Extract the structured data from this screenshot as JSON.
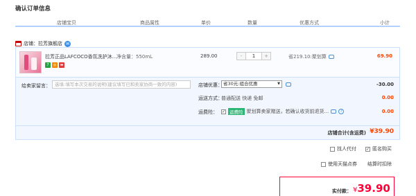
{
  "page_title": "确认订单信息",
  "columns": [
    "店铺宝贝",
    "商品属性",
    "单价",
    "数量",
    "优惠方式",
    "小计"
  ],
  "shop": {
    "label": "店铺：拉芳旗舰店"
  },
  "item": {
    "name": "拉芳正品LAFCOCO香氛洗护沐...",
    "spec": "净含量：550mL",
    "price": "289.00",
    "quantity": "1",
    "minus": "-",
    "plus": "+",
    "promo": "省219.10:聚划算",
    "subtotal": "69.90",
    "badges": [
      "7",
      "◎",
      "▬"
    ]
  },
  "options": {
    "message_label": "给卖家留言：",
    "message_placeholder": "选填:填写本次交易的说明(建议填写已和卖家协商一致的内容)",
    "discount_label": "店铺优惠：",
    "discount_select": "省30元:组合优惠",
    "discount_value": "-30.00",
    "shipping_label": "运送方式：",
    "shipping_text": "普通配送 快递 免邮",
    "shipping_value": "0.00",
    "insurance_label": "运费险：",
    "insurance_tag": "运费险",
    "insurance_text": "聚划算卖家赠送，若确认收货前退货...",
    "insurance_value": "0.00"
  },
  "shop_total": {
    "label": "店铺合计(含运费)",
    "value": "¥39.90"
  },
  "extras": {
    "pay_for_others": "找人代付",
    "anonymous": "匿名购买",
    "tmall_points": "使用天猫点券",
    "settle_note": "结算时扣除"
  },
  "payment": {
    "label": "实付款：",
    "currency": "¥",
    "value": "39.90"
  },
  "colors": {
    "accent": "#ff0036",
    "price": "#ff4400",
    "border": "#cde0fb"
  }
}
